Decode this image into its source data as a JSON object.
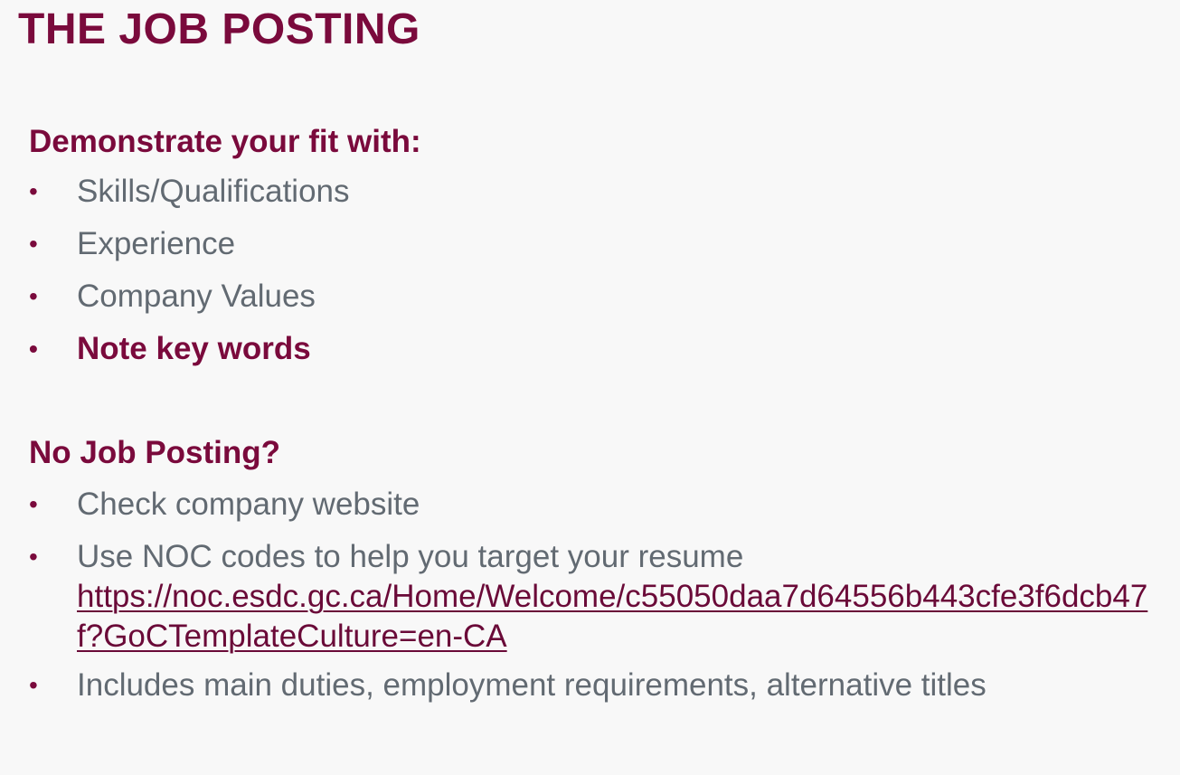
{
  "slide": {
    "title": "THE JOB POSTING",
    "accent_color": "#7a0a3c",
    "body_text_color": "#626a72"
  },
  "fit_section": {
    "heading": "Demonstrate your fit with:",
    "items": [
      "Skills/Qualifications",
      "Experience",
      "Company Values",
      "Note key words"
    ]
  },
  "no_posting_section": {
    "heading": "No Job Posting?",
    "items": [
      "Check company website",
      "Use NOC codes to help you target your resume",
      "Includes main duties, employment requirements, alternative titles"
    ],
    "noc_link": "https://noc.esdc.gc.ca/Home/Welcome/c55050daa7d64556b443cfe3f6dcb47f?GoCTemplateCulture=en-CA"
  },
  "bullet_glyph": "•"
}
